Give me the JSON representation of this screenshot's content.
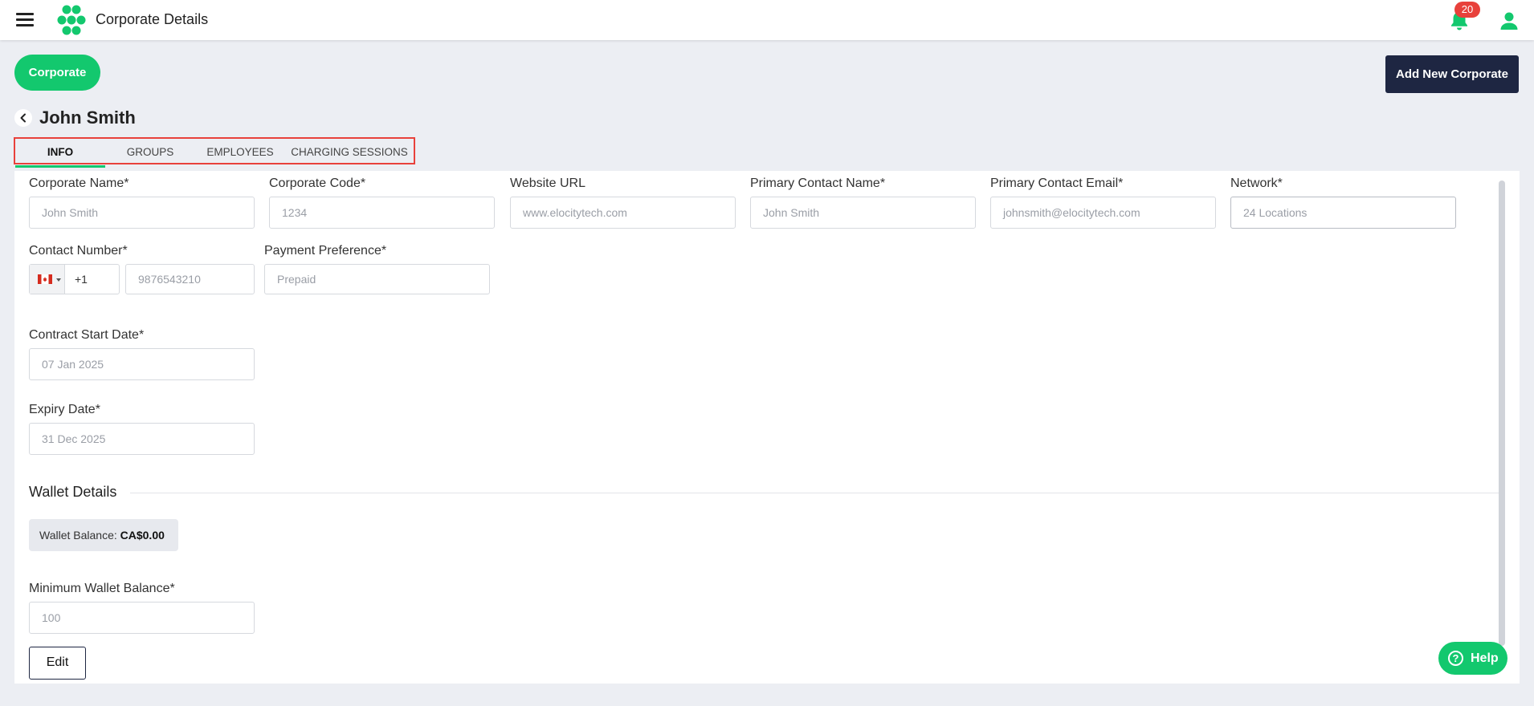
{
  "header": {
    "title": "Corporate Details",
    "notification_count": "20",
    "accent_color": "#13c86e",
    "badge_color": "#e8413b"
  },
  "toolbar": {
    "corporate_label": "Corporate",
    "add_new_label": "Add New Corporate"
  },
  "page": {
    "name": "John Smith"
  },
  "tabs": [
    {
      "label": "INFO",
      "active": true
    },
    {
      "label": "GROUPS",
      "active": false
    },
    {
      "label": "EMPLOYEES",
      "active": false
    },
    {
      "label": "CHARGING SESSIONS",
      "active": false
    }
  ],
  "form": {
    "corporate_name": {
      "label": "Corporate Name*",
      "placeholder": "John Smith"
    },
    "corporate_code": {
      "label": "Corporate Code*",
      "placeholder": "1234"
    },
    "website_url": {
      "label": "Website URL",
      "placeholder": "www.elocitytech.com"
    },
    "primary_contact_name": {
      "label": "Primary Contact Name*",
      "placeholder": "John Smith"
    },
    "primary_contact_email": {
      "label": "Primary Contact Email*",
      "placeholder": "johnsmith@elocitytech.com"
    },
    "network": {
      "label": "Network*",
      "placeholder": "24 Locations"
    },
    "contact_number": {
      "label": "Contact Number*",
      "dial_code": "+1",
      "placeholder": "9876543210",
      "country_flag": "canada-flag-icon"
    },
    "payment_preference": {
      "label": "Payment Preference*",
      "placeholder": "Prepaid"
    },
    "contract_start_date": {
      "label": "Contract Start Date*",
      "placeholder": "07 Jan 2025"
    },
    "expiry_date": {
      "label": "Expiry Date*",
      "placeholder": "31 Dec 2025"
    }
  },
  "wallet": {
    "section_title": "Wallet Details",
    "balance_label": "Wallet Balance:",
    "balance_value": "CA$0.00",
    "min_label": "Minimum Wallet Balance*",
    "min_placeholder": "100"
  },
  "actions": {
    "edit_label": "Edit",
    "help_label": "Help"
  }
}
